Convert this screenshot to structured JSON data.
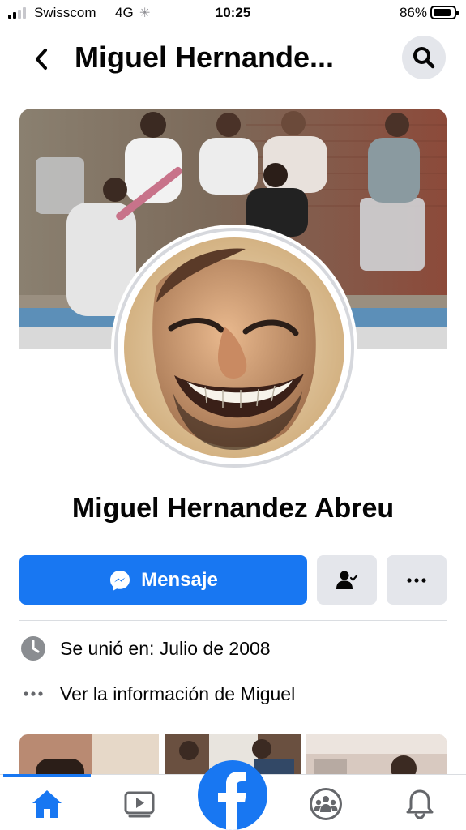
{
  "status_bar": {
    "carrier": "Swisscom",
    "network": "4G",
    "time": "10:25",
    "battery_percent": "86%",
    "battery_level": 0.86,
    "signal_bars": 2
  },
  "header": {
    "title": "Miguel Hernande...",
    "back_icon": "chevron-left-icon",
    "search_icon": "search-icon"
  },
  "profile": {
    "name": "Miguel Hernandez Abreu"
  },
  "actions": {
    "message_label": "Mensaje",
    "message_icon": "messenger-icon",
    "friends_icon": "friend-status-icon",
    "more_icon": "more-icon"
  },
  "details": [
    {
      "icon": "clock-icon",
      "text": "Se unió en: Julio de 2008"
    },
    {
      "icon": "more-icon",
      "text": "Ver la información de Miguel"
    }
  ],
  "tabbar": {
    "items": [
      "home-icon",
      "watch-icon",
      "facebook-logo",
      "groups-icon",
      "bell-icon"
    ],
    "active": "home-icon"
  },
  "colors": {
    "accent": "#1877f2",
    "button_gray": "#e4e6eb",
    "text": "#050505",
    "secondary": "#65676b"
  }
}
